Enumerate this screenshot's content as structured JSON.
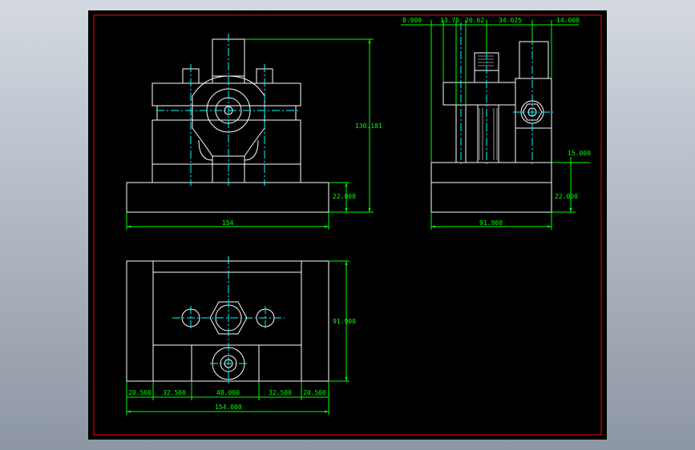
{
  "colors": {
    "background_top": "#d4d9e1",
    "background_bottom": "#8d96a3",
    "sheet": "#000000",
    "frame": "#ff0000",
    "outline": "#ffffff",
    "centerline": "#00ffff",
    "dimension": "#00ff00"
  },
  "dimensions": {
    "front_height": "130.181",
    "front_base_height": "22.000",
    "front_width": "154",
    "side_top_1": "8.900",
    "side_top_2": "13.75",
    "side_top_3": "20.62",
    "side_top_4": "34.625",
    "side_top_5": "14.000",
    "side_step": "15.000",
    "side_base_height": "22.000",
    "side_width": "91.900",
    "top_depth": "91.900",
    "top_seg_1": "20.500",
    "top_seg_2": "32.500",
    "top_seg_3": "48.000",
    "top_seg_4": "32.500",
    "top_seg_5": "20.500",
    "top_total": "154.000"
  }
}
